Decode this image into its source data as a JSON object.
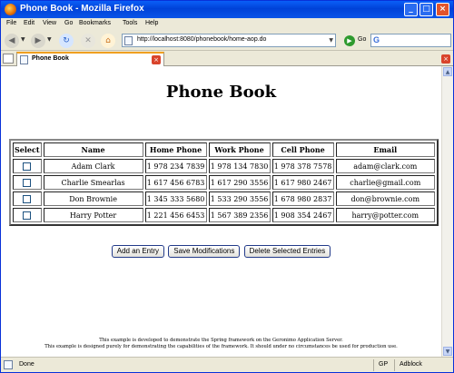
{
  "window": {
    "title": "Phone Book - Mozilla Firefox"
  },
  "menu": [
    "File",
    "Edit",
    "View",
    "Go",
    "Bookmarks",
    "Tools",
    "Help"
  ],
  "toolbar": {
    "url": "http://localhost:8080/phonebook/home-aop.do",
    "go_label": "Go",
    "search_icon": "G"
  },
  "tab": {
    "label": "Phone Book"
  },
  "page": {
    "title": "Phone Book",
    "columns": [
      "Select",
      "Name",
      "Home Phone",
      "Work Phone",
      "Cell Phone",
      "Email"
    ],
    "rows": [
      {
        "name": "Adam Clark",
        "home": "1 978 234 7839",
        "work": "1 978 134 7830",
        "cell": "1 978 378 7578",
        "email": "adam@clark.com"
      },
      {
        "name": "Charlie Smearlas",
        "home": "1 617 456 6783",
        "work": "1 617 290 3556",
        "cell": "1 617 980 2467",
        "email": "charlie@gmail.com"
      },
      {
        "name": "Don Brownie",
        "home": "1 345 333 5680",
        "work": "1 533 290 3556",
        "cell": "1 678 980 2837",
        "email": "don@brownie.com"
      },
      {
        "name": "Harry Potter",
        "home": "1 221 456 6453",
        "work": "1 567 389 2356",
        "cell": "1 908 354 2467",
        "email": "harry@potter.com"
      }
    ],
    "buttons": {
      "add": "Add an Entry",
      "save": "Save Modifications",
      "delete": "Delete Selected Entries"
    },
    "footer": [
      "This example is developed to demonstrate the Spring framework on the Geronimo Application Server.",
      "This example is designed purely for demonstrating the capabilities of the framework. It should under no circumstances be used for production use."
    ]
  },
  "status": {
    "text": "Done",
    "gp": "GP",
    "adblock": "Adblock"
  },
  "colors": {
    "titlebar": "#0042d8",
    "chrome": "#ece9d8",
    "close": "#e2542c"
  }
}
